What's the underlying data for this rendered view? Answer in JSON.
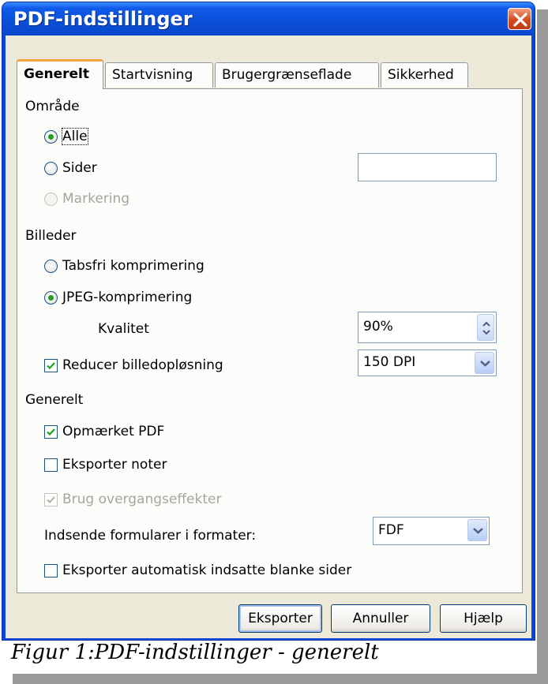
{
  "window": {
    "title": "PDF-indstillinger"
  },
  "tabs": [
    {
      "label": "Generelt",
      "active": true
    },
    {
      "label": "Startvisning",
      "active": false
    },
    {
      "label": "Brugergrænseflade",
      "active": false
    },
    {
      "label": "Sikkerhed",
      "active": false
    }
  ],
  "range": {
    "heading": "Område",
    "all": {
      "label": "Alle",
      "checked": true
    },
    "pages": {
      "label": "Sider",
      "checked": false,
      "value": ""
    },
    "selection": {
      "label": "Markering",
      "enabled": false
    }
  },
  "images": {
    "heading": "Billeder",
    "lossless": {
      "label": "Tabsfri komprimering",
      "checked": false
    },
    "jpeg": {
      "label": "JPEG-komprimering",
      "checked": true
    },
    "quality": {
      "label": "Kvalitet",
      "value": "90%"
    },
    "reduce": {
      "label": "Reducer billedopløsning",
      "checked": true,
      "value": "150 DPI"
    }
  },
  "general": {
    "heading": "Generelt",
    "tagged_pdf": {
      "label": "Opmærket PDF",
      "checked": true
    },
    "export_notes": {
      "label": "Eksporter noter",
      "checked": false
    },
    "transitions": {
      "label": "Brug overgangseffekter",
      "checked": true,
      "enabled": false
    },
    "form_format": {
      "label": "Indsende formularer i formater:",
      "value": "FDF"
    },
    "blank_pages": {
      "label": "Eksporter automatisk indsatte blanke sider",
      "checked": false
    }
  },
  "buttons": {
    "export": "Eksporter",
    "cancel": "Annuller",
    "help": "Hjælp"
  },
  "caption": "Figur 1:PDF-indstillinger - generelt",
  "colors": {
    "titlebar": "#0a4fd8",
    "dialog_bg": "#ece9d8",
    "radio_dot": "#21a121",
    "close": "#d44a1e",
    "tab_highlight": "#f2a53a"
  },
  "icons": {
    "close": "close-x-icon",
    "spin": "spinner-arrows-icon",
    "dropdown": "chevron-down-icon",
    "check": "checkmark-icon"
  }
}
